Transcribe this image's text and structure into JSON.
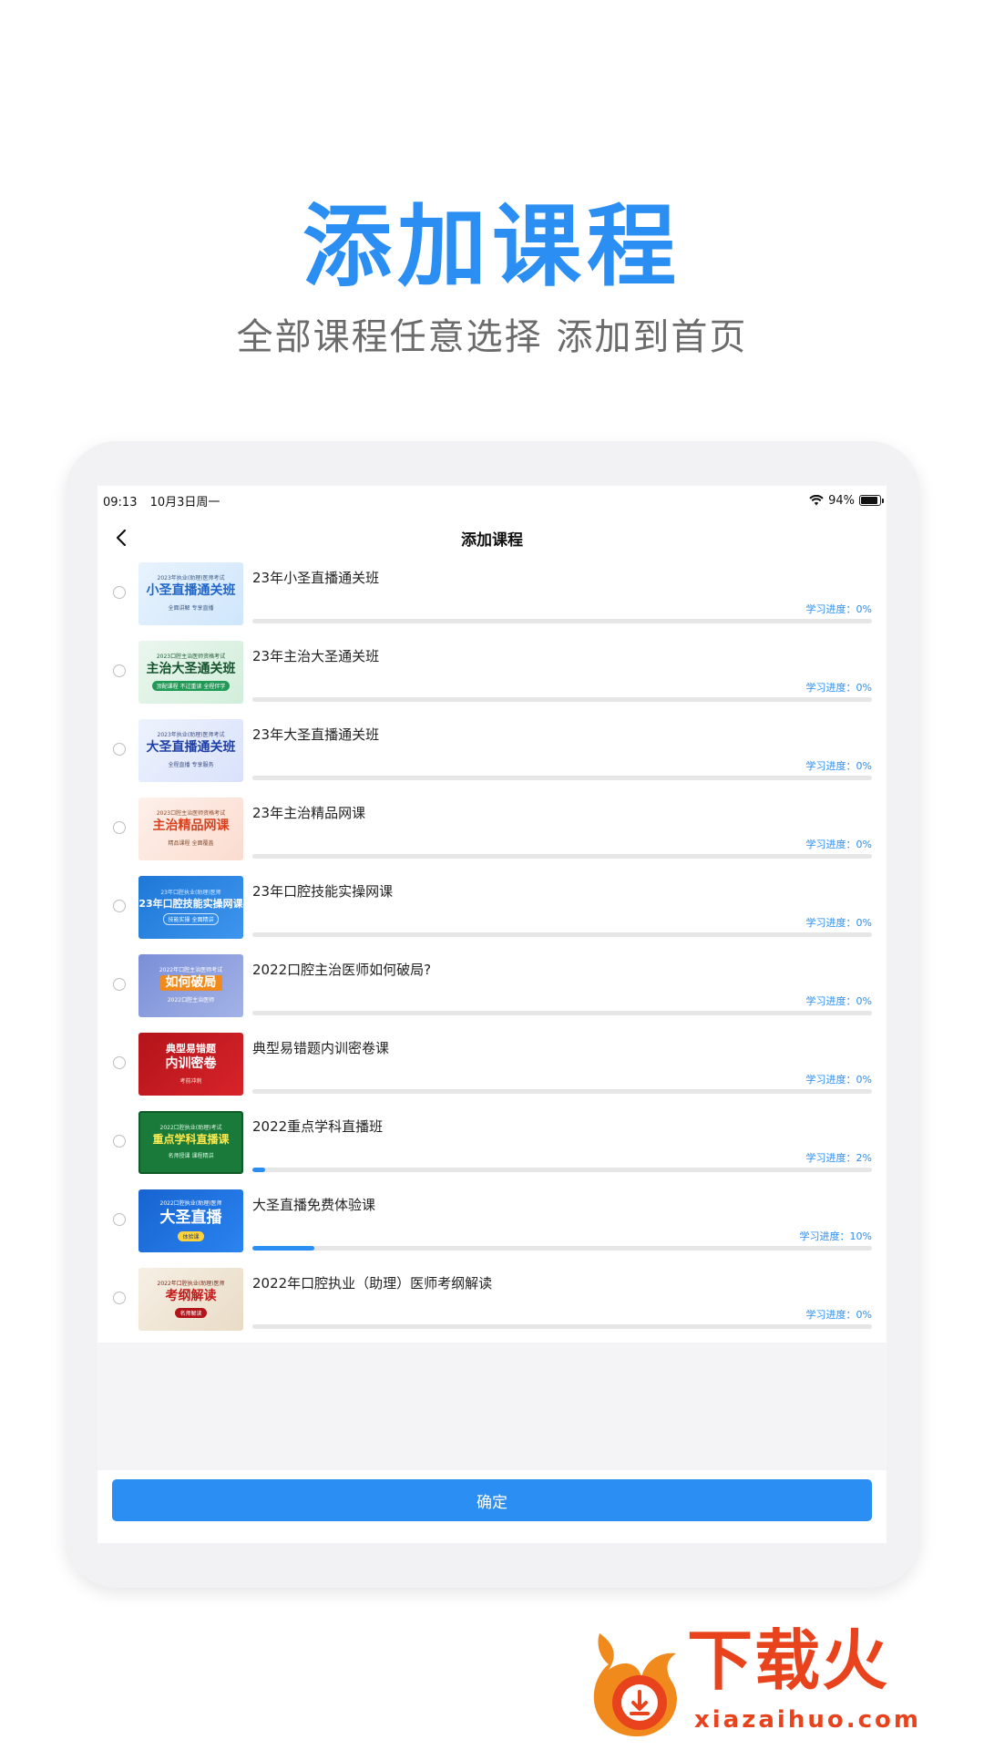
{
  "hero": {
    "title": "添加课程",
    "subtitle": "全部课程任意选择 添加到首页"
  },
  "statusbar": {
    "time": "09:13",
    "date": "10月3日周一",
    "battery": "94%"
  },
  "nav": {
    "title": "添加课程"
  },
  "courses": [
    {
      "name": "23年小圣直播通关班",
      "progress_label": "学习进度：0%",
      "progress": 0,
      "thumb": {
        "top": "2023年执业(助理)医师考试",
        "big": "小圣直播通关班",
        "pill": "全面讲解 专享直播"
      }
    },
    {
      "name": "23年主治大圣通关班",
      "progress_label": "学习进度：0%",
      "progress": 0,
      "thumb": {
        "top": "2023口腔主治医师资格考试",
        "big": "主治大圣通关班",
        "pill": "顶配课程 不过重读 全程伴学"
      }
    },
    {
      "name": "23年大圣直播通关班",
      "progress_label": "学习进度：0%",
      "progress": 0,
      "thumb": {
        "top": "2023年执业(助理)医师考试",
        "big": "大圣直播通关班",
        "pill": "全程直播 专享服务"
      }
    },
    {
      "name": "23年主治精品网课",
      "progress_label": "学习进度：0%",
      "progress": 0,
      "thumb": {
        "top": "2023口腔主治医师资格考试",
        "big": "主治精品网课",
        "pill": "精品课程 全面覆盖"
      }
    },
    {
      "name": "23年口腔技能实操网课",
      "progress_label": "学习进度：0%",
      "progress": 0,
      "thumb": {
        "top": "23年口腔执业(助理)医师",
        "big": "23年口腔技能实操网课",
        "pill": "技能实操 全面精讲"
      }
    },
    {
      "name": "2022口腔主治医师如何破局?",
      "progress_label": "学习进度：0%",
      "progress": 0,
      "thumb": {
        "top": "2022年口腔主治医师考试",
        "big": "如何破局",
        "pill": "2022口腔主治医师"
      }
    },
    {
      "name": "典型易错题内训密卷课",
      "progress_label": "学习进度：0%",
      "progress": 0,
      "thumb": {
        "top": "典型易错题",
        "big": "内训密卷",
        "pill": "考前冲刺"
      }
    },
    {
      "name": "2022重点学科直播班",
      "progress_label": "学习进度：2%",
      "progress": 2,
      "thumb": {
        "top": "2022口腔执业(助理)考试",
        "big": "重点学科直播课",
        "pill": "名师授课 课程精讲"
      }
    },
    {
      "name": "大圣直播免费体验课",
      "progress_label": "学习进度：10%",
      "progress": 10,
      "thumb": {
        "top": "2022口腔执业(助理)医师",
        "big": "大圣直播",
        "pill": "体验课"
      }
    },
    {
      "name": "2022年口腔执业（助理）医师考纲解读",
      "progress_label": "学习进度：0%",
      "progress": 0,
      "thumb": {
        "top": "2022年口腔执业(助理)医师",
        "big": "考纲解读",
        "pill": "名师解读"
      }
    }
  ],
  "confirm": {
    "label": "确定"
  },
  "watermark": {
    "brand": "下载火",
    "url": "xiazaihuo.com"
  },
  "colors": {
    "accent": "#2a8ef2",
    "brand": "#e8431c"
  }
}
